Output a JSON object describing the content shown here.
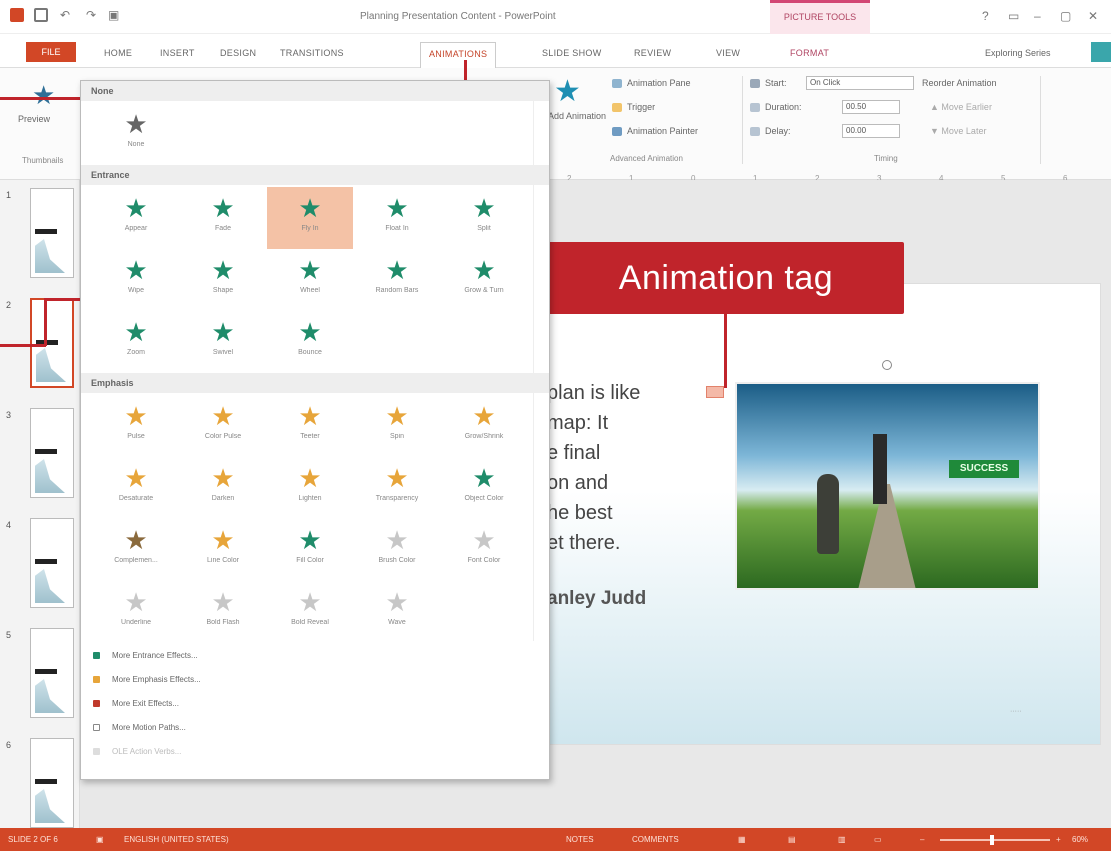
{
  "app": {
    "title": "Planning Presentation Content - PowerPoint",
    "context_group": "PICTURE TOOLS",
    "user": "Exploring Series",
    "window_buttons": [
      "?",
      "▭",
      "–",
      "▢",
      "✕"
    ]
  },
  "tabs": [
    "FILE",
    "HOME",
    "INSERT",
    "DESIGN",
    "TRANSITIONS",
    "ANIMATIONS",
    "SLIDE SHOW",
    "REVIEW",
    "VIEW",
    "FORMAT"
  ],
  "ribbon": {
    "preview": "Preview",
    "add_animation": "Add Animation",
    "animation_pane": "Animation Pane",
    "trigger": "Trigger",
    "animation_painter": "Animation Painter",
    "start_label": "Start:",
    "start_value": "On Click",
    "duration_label": "Duration:",
    "duration_value": "00.50",
    "delay_label": "Delay:",
    "delay_value": "00.00",
    "reorder_title": "Reorder Animation",
    "move_earlier": "Move Earlier",
    "move_later": "Move Later",
    "group_advanced": "Advanced Animation",
    "group_timing": "Timing",
    "thumbnails_label": "Thumbnails",
    "ruler": [
      "2",
      "1",
      "0",
      "1",
      "2",
      "3",
      "4",
      "5",
      "6"
    ]
  },
  "gallery": {
    "none_header": "None",
    "none_item": "None",
    "entrance_header": "Entrance",
    "entrance": [
      "Appear",
      "Fade",
      "Fly In",
      "Float In",
      "Split",
      "Wipe",
      "Shape",
      "Wheel",
      "Random Bars",
      "Grow & Turn",
      "Zoom",
      "Swivel",
      "Bounce"
    ],
    "emphasis_header": "Emphasis",
    "emphasis": [
      "Pulse",
      "Color Pulse",
      "Teeter",
      "Spin",
      "Grow/Shrink",
      "Desaturate",
      "Darken",
      "Lighten",
      "Transparency",
      "Object Color",
      "Complemen...",
      "Line Color",
      "Fill Color",
      "Brush Color",
      "Font Color",
      "Underline",
      "Bold Flash",
      "Bold Reveal",
      "Wave"
    ],
    "more": [
      "More Entrance Effects...",
      "More Emphasis Effects...",
      "More Exit Effects...",
      "More Motion Paths...",
      "OLE Action Verbs..."
    ]
  },
  "slide": {
    "lines": [
      "plan is like",
      "map: It",
      "e final",
      "on and",
      "he best",
      "et there."
    ],
    "author": "anley Judd",
    "sign_text": "SUCCESS"
  },
  "callout": "Animation tag",
  "thumbnails": [
    "1",
    "2",
    "3",
    "4",
    "5",
    "6"
  ],
  "status": {
    "slide": "SLIDE 2 OF 6",
    "notes_lang": "ENGLISH (UNITED STATES)",
    "notes": "NOTES",
    "comments": "COMMENTS",
    "zoom": "60%"
  },
  "colors": {
    "accent": "#d24726",
    "callout": "#c0242b",
    "entrance_star": "#1f8c6a",
    "emphasis_star": "#e7a53a",
    "selected_item": "#f4c2a6"
  }
}
